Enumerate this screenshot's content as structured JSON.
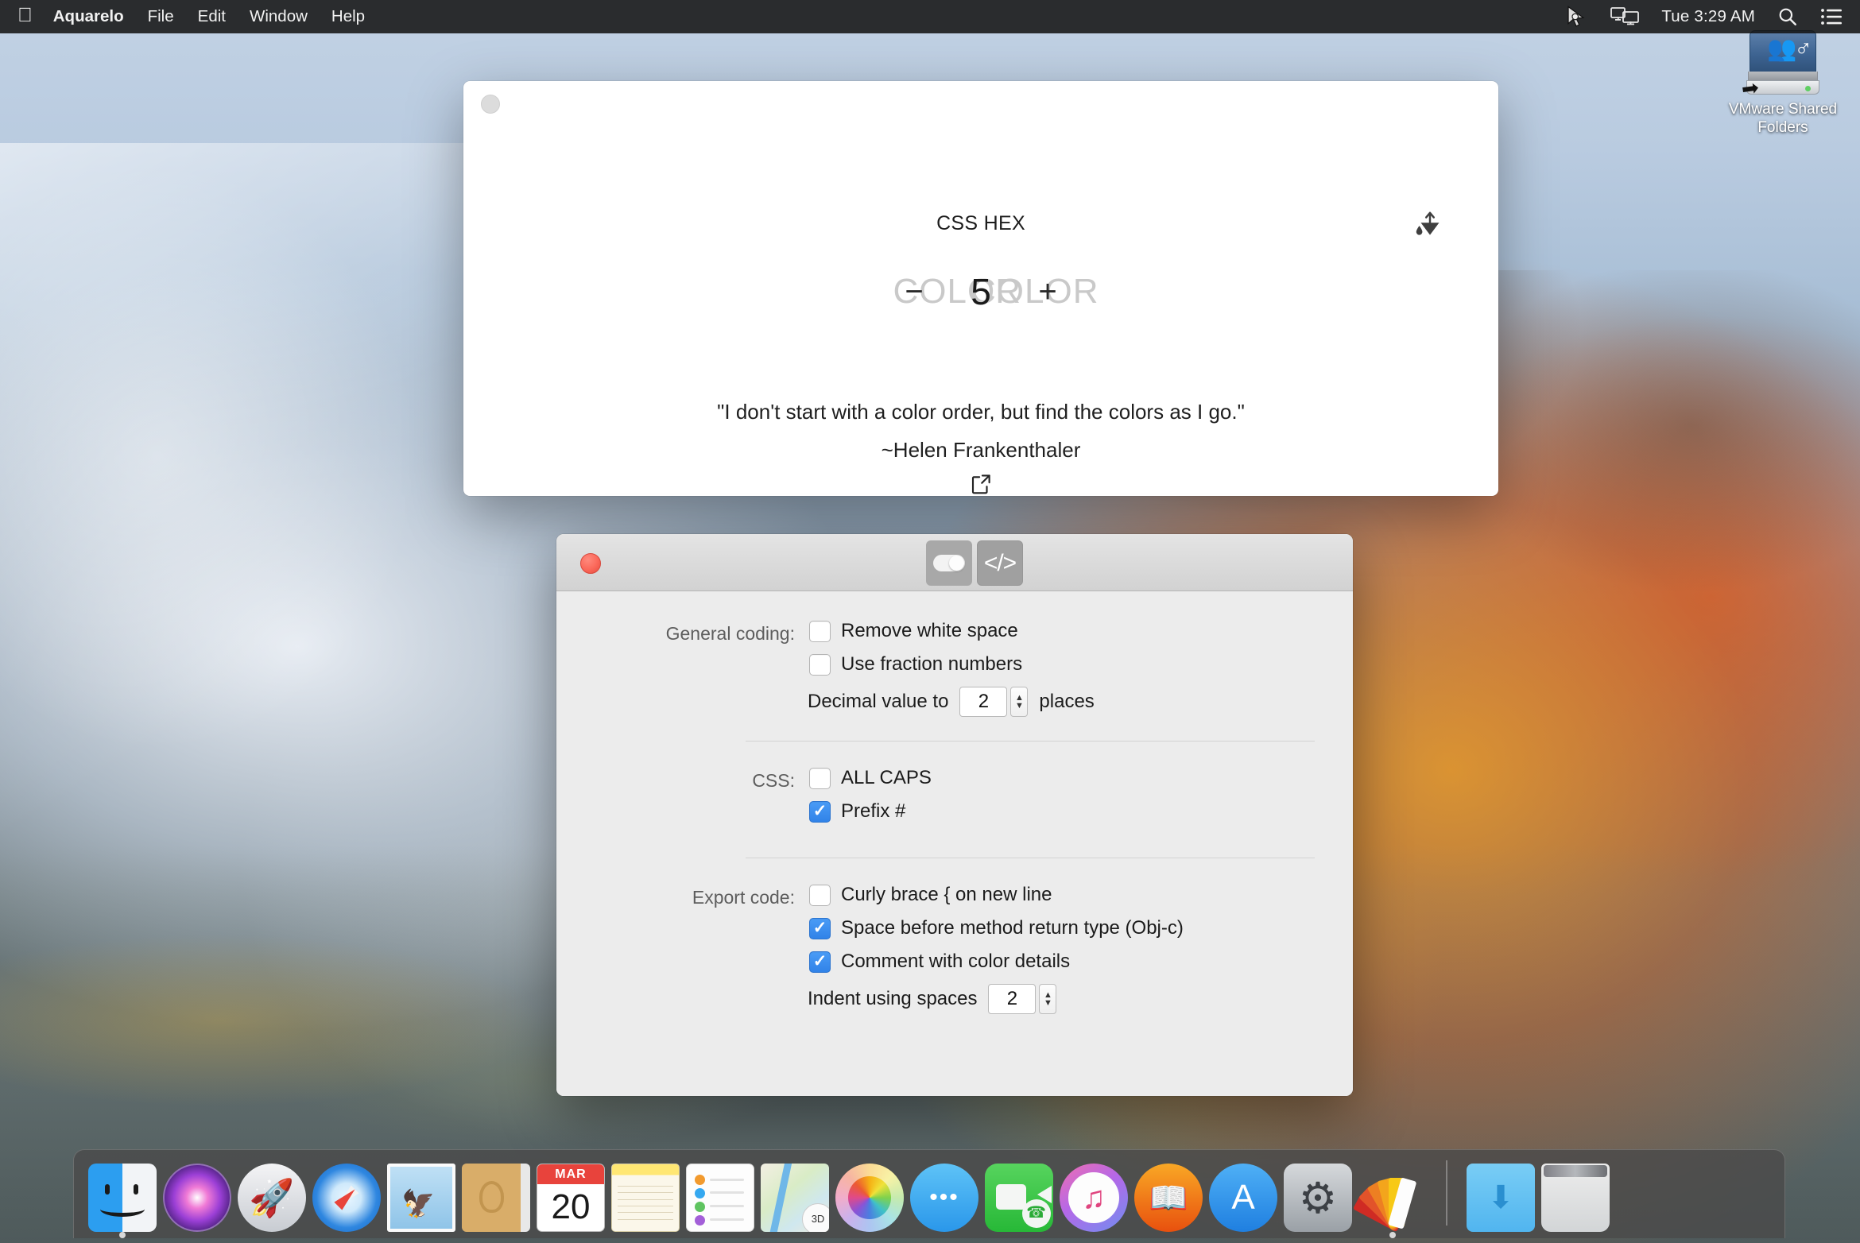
{
  "menubar": {
    "apple_glyph": "apple-logo",
    "app_title": "Aquarelo",
    "items": [
      "File",
      "Edit",
      "Window",
      "Help"
    ],
    "status_icons": [
      "vmware-pointer-icon",
      "screen-sharing-icon"
    ],
    "clock": "Tue 3:29 AM",
    "right_icons": [
      "search-icon",
      "control-center-icon"
    ]
  },
  "desktop": {
    "drive": {
      "label": "VMware Shared Folders",
      "icon": "shared-folders-drive-icon"
    }
  },
  "main_window": {
    "title": "CSS HEX",
    "export_icon": "paint-export-icon",
    "color_left_placeholder": "COLOR",
    "color_right_placeholder": "COLOR",
    "stepper": {
      "minus": "−",
      "value": "5",
      "plus": "+"
    },
    "quote_line1": "\"I don't start with a color order, but find the colors as I go.\"",
    "quote_line2": "~Helen Frankenthaler",
    "share_icon": "open-external-icon"
  },
  "prefs_window": {
    "tabs": [
      {
        "name": "general-toggle-tab",
        "icon": "toggle-switch-icon",
        "selected": false
      },
      {
        "name": "code-tab",
        "icon": "code-brackets-icon",
        "selected": true
      }
    ],
    "sections": [
      {
        "label": "General coding:",
        "checkboxes": [
          {
            "label": "Remove white space",
            "checked": false
          },
          {
            "label": "Use fraction numbers",
            "checked": false
          }
        ],
        "stepper": {
          "prefix": "Decimal value to",
          "value": "2",
          "suffix": "places"
        }
      },
      {
        "label": "CSS:",
        "checkboxes": [
          {
            "label": "ALL CAPS",
            "checked": false
          },
          {
            "label": "Prefix #",
            "checked": true
          }
        ]
      },
      {
        "label": "Export code:",
        "checkboxes": [
          {
            "label": "Curly brace  {  on new line",
            "checked": false
          },
          {
            "label": "Space before method return type (Obj-c)",
            "checked": true
          },
          {
            "label": "Comment with color details",
            "checked": true
          }
        ],
        "stepper": {
          "prefix": "Indent using spaces",
          "value": "2",
          "suffix": ""
        }
      }
    ]
  },
  "dock": {
    "items": [
      {
        "name": "finder",
        "label": "Finder",
        "running": true
      },
      {
        "name": "siri",
        "label": "Siri",
        "running": false
      },
      {
        "name": "launchpad",
        "label": "Launchpad",
        "running": false
      },
      {
        "name": "safari",
        "label": "Safari",
        "running": false
      },
      {
        "name": "mail",
        "label": "Mail",
        "running": false
      },
      {
        "name": "contacts",
        "label": "Contacts",
        "running": false
      },
      {
        "name": "calendar",
        "label": "Calendar",
        "month": "MAR",
        "day": "20",
        "running": false
      },
      {
        "name": "notes",
        "label": "Notes",
        "running": false
      },
      {
        "name": "reminders",
        "label": "Reminders",
        "running": false
      },
      {
        "name": "maps",
        "label": "Maps",
        "badge": "3D",
        "running": false
      },
      {
        "name": "photos",
        "label": "Photos",
        "running": false
      },
      {
        "name": "messages",
        "label": "Messages",
        "running": false
      },
      {
        "name": "facetime",
        "label": "FaceTime",
        "running": false
      },
      {
        "name": "itunes",
        "label": "iTunes",
        "running": false
      },
      {
        "name": "ibooks",
        "label": "iBooks",
        "running": false
      },
      {
        "name": "app-store",
        "label": "App Store",
        "running": false
      },
      {
        "name": "system-preferences",
        "label": "System Preferences",
        "running": false
      },
      {
        "name": "aquarelo",
        "label": "Aquarelo",
        "running": true
      }
    ],
    "right_items": [
      {
        "name": "downloads-folder",
        "label": "Downloads"
      },
      {
        "name": "trash",
        "label": "Trash"
      }
    ]
  },
  "colors": {
    "accent_blue": "#3183e8",
    "close_red": "#fb6a5c",
    "menubar_bg": "#141414",
    "prefs_bg": "#ececec"
  }
}
